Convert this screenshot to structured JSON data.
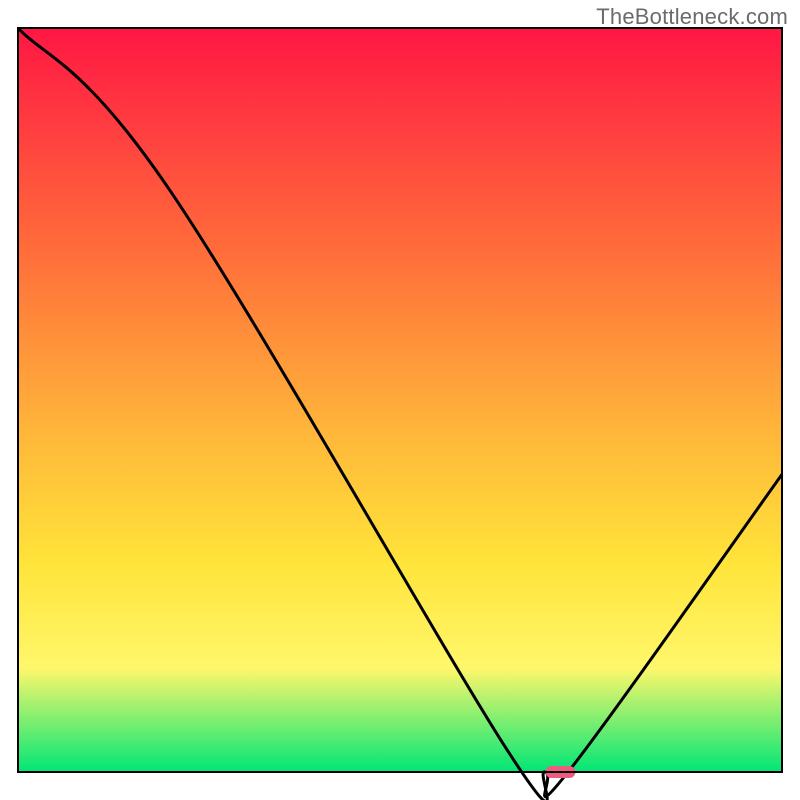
{
  "watermark": "TheBottleneck.com",
  "colors": {
    "gradient_top": "#ff1744",
    "gradient_mid_upper": "#ff6d3a",
    "gradient_mid": "#ffb83a",
    "gradient_mid_lower": "#ffe43a",
    "gradient_lower": "#fff76b",
    "gradient_bottom": "#00e676",
    "curve_stroke": "#000000",
    "marker_fill": "#ef5a80",
    "axis_stroke": "#000000"
  },
  "chart_data": {
    "type": "line",
    "title": "",
    "xlabel": "",
    "ylabel": "",
    "xlim": [
      0,
      100
    ],
    "ylim": [
      0,
      100
    ],
    "series": [
      {
        "name": "bottleneck-curve",
        "x": [
          0,
          20,
          64,
          69,
          72,
          100
        ],
        "y": [
          100,
          78,
          3,
          0,
          0,
          40
        ]
      }
    ],
    "annotations": [
      {
        "name": "optimal-marker",
        "type": "marker-capsule",
        "x": 71,
        "y": 0
      }
    ],
    "background": {
      "type": "vertical-gradient",
      "description": "red-to-green bottleneck heat gradient",
      "stops": [
        {
          "offset": 0.0,
          "color": "#ff1744"
        },
        {
          "offset": 0.3,
          "color": "#ff6d3a"
        },
        {
          "offset": 0.55,
          "color": "#ffb83a"
        },
        {
          "offset": 0.72,
          "color": "#ffe43a"
        },
        {
          "offset": 0.86,
          "color": "#fff76b"
        },
        {
          "offset": 1.0,
          "color": "#00e676"
        }
      ]
    }
  }
}
